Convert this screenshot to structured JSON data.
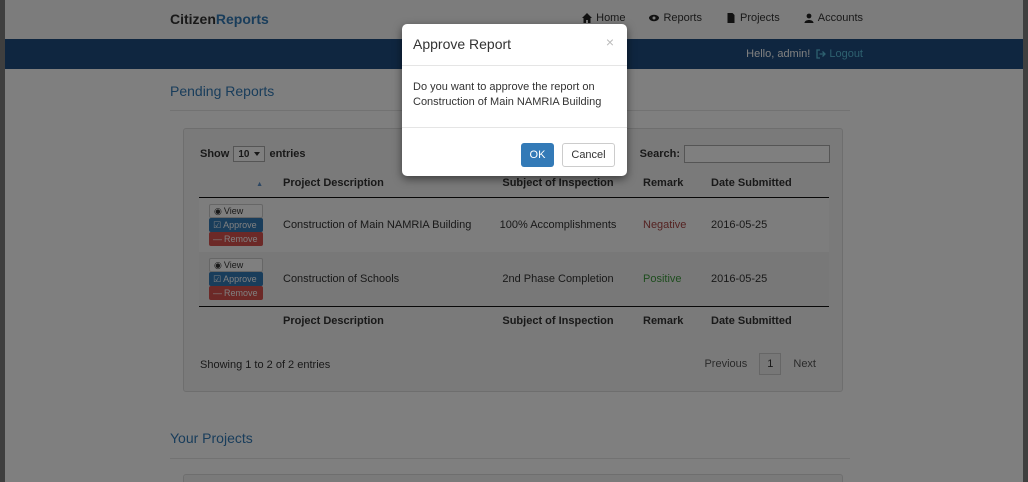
{
  "navbar": {
    "brand_bold": "Citizen",
    "brand_accent": "Reports",
    "items": [
      {
        "label": "Home",
        "icon": "home-icon"
      },
      {
        "label": "Reports",
        "icon": "eye-icon"
      },
      {
        "label": "Projects",
        "icon": "file-icon"
      },
      {
        "label": "Accounts",
        "icon": "user-icon"
      }
    ]
  },
  "userbar": {
    "greeting": "Hello, admin!",
    "logout_label": "Logout"
  },
  "pending": {
    "title": "Pending Reports",
    "show_label": "Show",
    "entries_label": "entries",
    "page_size": "10",
    "search_label": "Search:",
    "search_value": "",
    "columns": [
      "Project Description",
      "Subject of Inspection",
      "Remark",
      "Date Submitted"
    ],
    "action_labels": {
      "view": "View",
      "approve": "Approve",
      "remove": "Remove"
    },
    "rows": [
      {
        "project": "Construction of Main NAMRIA Building",
        "subject": "100% Accomplishments",
        "remark": "Negative",
        "date": "2016-05-25"
      },
      {
        "project": "Construction of Schools",
        "subject": "2nd Phase Completion",
        "remark": "Positive",
        "date": "2016-05-25"
      }
    ],
    "info": "Showing 1 to 2 of 2 entries",
    "pager": {
      "previous": "Previous",
      "current": "1",
      "next": "Next"
    }
  },
  "projects": {
    "title": "Your Projects"
  },
  "modal": {
    "title": "Approve Report",
    "close": "×",
    "body_line1": "Do you want to approve the report on",
    "body_line2": "Construction of Main NAMRIA Building",
    "ok_label": "OK",
    "cancel_label": "Cancel"
  },
  "colors": {
    "navbar_blue": "#1f4d80",
    "primary": "#337ab7",
    "danger": "#d9534f",
    "negative": "#a94442",
    "positive": "#3c9a3c"
  }
}
